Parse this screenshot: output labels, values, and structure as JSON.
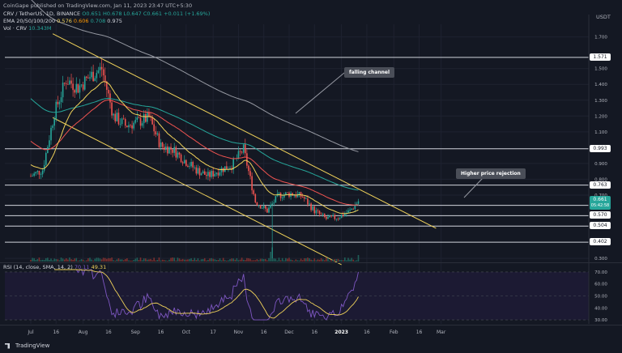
{
  "publisher": "CoinGape published on TradingView.com, Jan 11, 2023 23:47 UTC+5:30",
  "symbol_line": {
    "symbol": "CRV / TetherUS, 1D, BINANCE",
    "ohlc": "O0.651 H0.678 L0.647 C0.661 +0.011 (+1.69%)"
  },
  "ema_line": {
    "label": "EMA 20/50/100/200",
    "v20": "0.576",
    "v50": "0.606",
    "v100": "0.708",
    "v200": "0.975"
  },
  "vol_line": {
    "label": "Vol · CRV",
    "value": "10.343M"
  },
  "rsi_line": {
    "label": "RSI (14, close, SMA, 14, 2)",
    "rsi": "70.11",
    "sma": "49.31"
  },
  "axis_currency": "USDT",
  "annotations": {
    "channel": "falling channel",
    "rejection": "Higher price rejection"
  },
  "footer": "TradingView",
  "colors": {
    "up": "#26a69a",
    "down": "#ef5350",
    "ema20": "#f0d25a",
    "ema50": "#ef5350",
    "ema100": "#26a69a",
    "ema200": "#9598a1",
    "channel": "#f0d25a",
    "rsi": "#7e57c2",
    "rsi_ma": "#f0d25a"
  },
  "chart_data": [
    {
      "type": "candlestick",
      "x_ticks": [
        "Jul",
        "16",
        "Aug",
        "16",
        "Sep",
        "16",
        "Oct",
        "17",
        "Nov",
        "16",
        "Dec",
        "16",
        "2023",
        "16",
        "Feb",
        "16",
        "Mar"
      ],
      "y_ticks": [
        "1.700",
        "1.500",
        "1.400",
        "1.300",
        "1.200",
        "1.100",
        "0.900",
        "0.800",
        "0.700",
        "0.300"
      ],
      "ylim": [
        0.28,
        1.78
      ],
      "price_levels": [
        "1.571",
        "0.993",
        "0.763",
        "0.635",
        "0.570",
        "0.504",
        "0.402"
      ],
      "current_price": "0.661",
      "countdown": "05:42:58",
      "ema_values": {
        "ema20": 0.576,
        "ema50": 0.606,
        "ema100": 0.708,
        "ema200": 0.975
      },
      "falling_channel": {
        "upper": [
          [
            "Jul 14",
            1.72
          ],
          [
            "Feb 26",
            0.49
          ]
        ],
        "lower": [
          [
            "Jul 14",
            1.19
          ],
          [
            "Jan 1",
            0.26
          ]
        ]
      },
      "closes_approx": [
        [
          "Jul 1",
          0.82
        ],
        [
          "Jul 8",
          0.86
        ],
        [
          "Jul 15",
          1.22
        ],
        [
          "Jul 22",
          1.43
        ],
        [
          "Jul 29",
          1.38
        ],
        [
          "Aug 5",
          1.45
        ],
        [
          "Aug 12",
          1.5
        ],
        [
          "Aug 19",
          1.2
        ],
        [
          "Aug 26",
          1.14
        ],
        [
          "Sep 2",
          1.16
        ],
        [
          "Sep 9",
          1.19
        ],
        [
          "Sep 16",
          1.01
        ],
        [
          "Sep 23",
          0.99
        ],
        [
          "Sep 30",
          0.92
        ],
        [
          "Oct 7",
          0.86
        ],
        [
          "Oct 14",
          0.82
        ],
        [
          "Oct 21",
          0.86
        ],
        [
          "Oct 28",
          0.89
        ],
        [
          "Nov 4",
          0.99
        ],
        [
          "Nov 11",
          0.66
        ],
        [
          "Nov 18",
          0.6
        ],
        [
          "Nov 25",
          0.7
        ],
        [
          "Dec 2",
          0.71
        ],
        [
          "Dec 9",
          0.69
        ],
        [
          "Dec 16",
          0.6
        ],
        [
          "Dec 23",
          0.55
        ],
        [
          "Dec 30",
          0.56
        ],
        [
          "Jan 6",
          0.6
        ],
        [
          "Jan 11",
          0.661
        ]
      ]
    },
    {
      "type": "line",
      "name": "RSI",
      "y_ticks": [
        "70.00",
        "60.00",
        "50.00",
        "40.00",
        "30.00"
      ],
      "ylim": [
        28,
        72
      ],
      "rsi": 70.11,
      "rsi_sma": 49.31
    }
  ]
}
